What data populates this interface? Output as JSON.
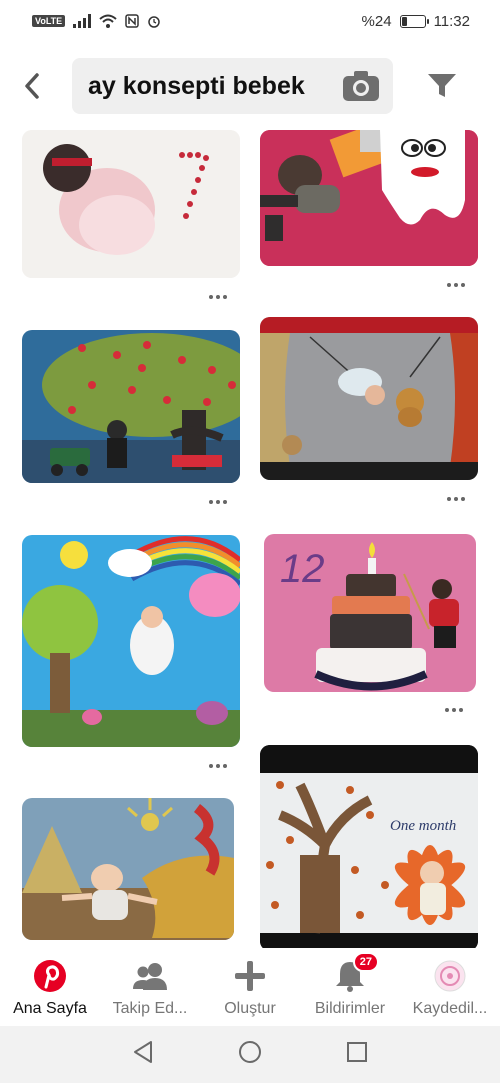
{
  "status_bar": {
    "network_badge": "VoLTE",
    "battery_text": "%24",
    "battery_level": 0.24,
    "time": "11:32"
  },
  "search": {
    "query": "ay konsepti bebek",
    "back_icon": "chevron-left-icon",
    "camera_icon": "camera-icon",
    "filter_icon": "filter-icon"
  },
  "pins": [
    {
      "id": "pin-1",
      "description": "baby with number 7"
    },
    {
      "id": "pin-2",
      "description": "baby with tooth"
    },
    {
      "id": "pin-3",
      "description": "tree with hearts"
    },
    {
      "id": "pin-4",
      "description": "stage with lion"
    },
    {
      "id": "pin-5",
      "description": "rainbow balloon"
    },
    {
      "id": "pin-6",
      "description": "birthday cake 12"
    },
    {
      "id": "pin-7",
      "description": "desert sun"
    },
    {
      "id": "pin-8",
      "caption": "One month"
    }
  ],
  "bottom_nav": {
    "items": [
      {
        "label": "Ana Sayfa",
        "icon": "pinterest-logo-icon",
        "active": true
      },
      {
        "label": "Takip Ed...",
        "icon": "people-icon"
      },
      {
        "label": "Oluştur",
        "icon": "plus-icon"
      },
      {
        "label": "Bildirimler",
        "icon": "bell-icon",
        "badge": "27"
      },
      {
        "label": "Kaydedil...",
        "icon": "profile-avatar-icon"
      }
    ]
  },
  "colors": {
    "accent": "#e60023",
    "nav_inactive": "#767676",
    "search_bg": "#efefef"
  }
}
